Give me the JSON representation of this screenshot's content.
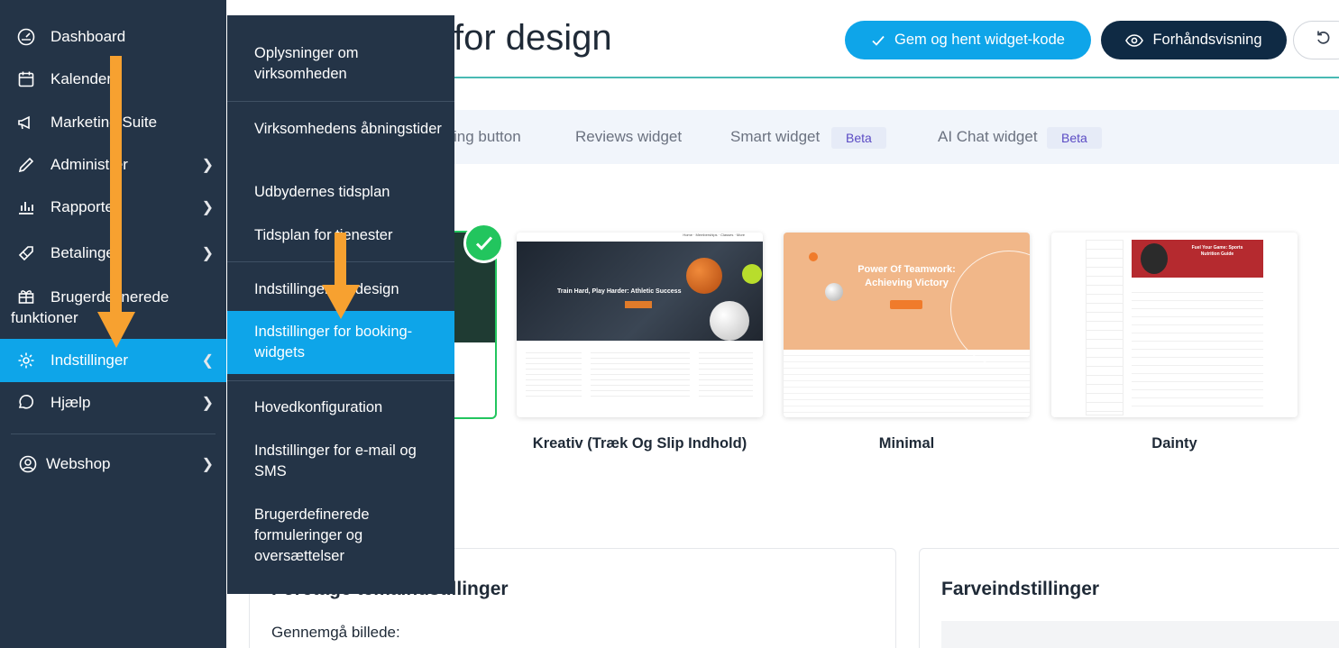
{
  "sidebar": {
    "items": [
      {
        "label": "Dashboard",
        "icon": "speedometer-icon"
      },
      {
        "label": "Kalender",
        "icon": "calendar-icon"
      },
      {
        "label": "Marketing Suite",
        "icon": "megaphone-icon"
      },
      {
        "label": "Administrer",
        "icon": "pencil-icon"
      },
      {
        "label": "Rapporter",
        "icon": "bar-chart-icon"
      },
      {
        "label": "Betalinger",
        "icon": "tag-icon"
      },
      {
        "label": "Brugerdefinerede funktioner",
        "icon": "gift-icon"
      },
      {
        "label": "Indstillinger",
        "icon": "gear-icon"
      },
      {
        "label": "Hjælp",
        "icon": "chat-icon"
      },
      {
        "label": "Webshop",
        "icon": "user-circle-icon"
      }
    ]
  },
  "submenu": {
    "items": [
      {
        "label": "Oplysninger om virksomheden"
      },
      {
        "label": "Virksomhedens åbningstider"
      },
      {
        "label": "Udbydernes tidsplan"
      },
      {
        "label": "Tidsplan for tjenester"
      },
      {
        "label": "Indstillinger for design"
      },
      {
        "label": "Indstillinger for booking-widgets"
      },
      {
        "label": "Hovedkonfiguration"
      },
      {
        "label": "Indstillinger for e-mail og SMS"
      },
      {
        "label": "Brugerdefinerede formuleringer og oversættelser"
      }
    ]
  },
  "header": {
    "title_visible": "for design",
    "save_button": "Gem og hent widget-kode",
    "preview_button": "Forhåndsvisning"
  },
  "tabs": {
    "booking_button_partial": "ing button",
    "reviews": "Reviews widget",
    "smart": "Smart widget",
    "ai_chat": "AI Chat widget",
    "beta": "Beta"
  },
  "themes": {
    "kreativ": "Kreativ (Træk Og Slip Indhold)",
    "minimal": "Minimal",
    "dainty": "Dainty",
    "kreativ_hero": "Train Hard, Play Harder: Athletic Success",
    "minimal_hero": "Power Of Teamwork: Achieving Victory",
    "dainty_hero": "Fuel Your Game: Sports Nutrition Guide"
  },
  "panels": {
    "theme_title": "Foretage temaindstillinger",
    "theme_sub": "Gennemgå billede:",
    "color_title": "Farveindstillinger"
  },
  "colors": {
    "sidebar": "#243447",
    "accent": "#0ea5e9",
    "arrow": "#f7a130"
  }
}
